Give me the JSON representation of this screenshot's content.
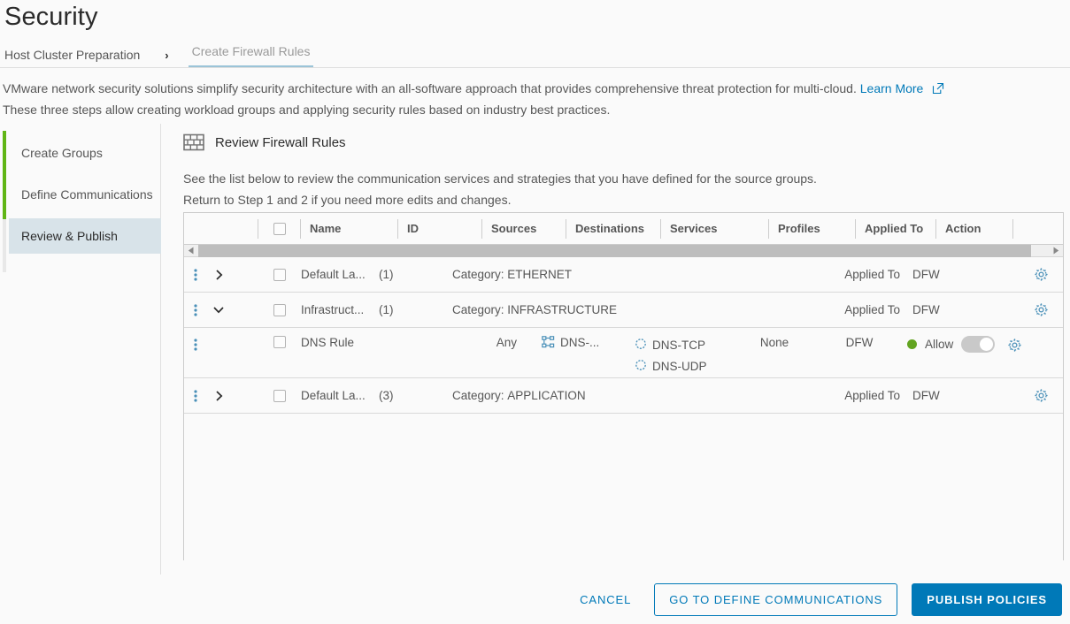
{
  "page": {
    "title": "Security"
  },
  "breadcrumb": {
    "root": "Host Cluster Preparation",
    "separator": "›",
    "current": "Create Firewall Rules"
  },
  "intro": {
    "line1_before_link": "VMware network security solutions simplify security architecture with an all-software approach that provides comprehensive threat protection for multi-cloud.",
    "link_label": "Learn More",
    "link_icon": "external-link-icon",
    "line2": "These three steps allow creating workload groups and applying security rules based on industry best practices."
  },
  "steps": {
    "items": [
      {
        "label": "Create Groups",
        "state": "complete"
      },
      {
        "label": "Define Communications",
        "state": "complete"
      },
      {
        "label": "Review & Publish",
        "state": "active"
      }
    ],
    "accent_color": "#60b515",
    "active_bg": "#d8e3e9"
  },
  "panel": {
    "icon": "firewall-brick-icon",
    "title": "Review Firewall Rules",
    "desc_line1": "See the list below to review the communication services and strategies that you have defined for the source groups.",
    "desc_line2": "Return to Step 1 and 2 if you need more edits and changes."
  },
  "table": {
    "columns": [
      "Name",
      "ID",
      "Sources",
      "Destinations",
      "Services",
      "Profiles",
      "Applied To",
      "Action"
    ],
    "select_all_checkbox": "unchecked",
    "scrollbar": {
      "left_arrow_icon": "triangle-left-icon",
      "right_arrow_icon": "triangle-right-icon",
      "thumb_position": "left"
    },
    "rows": [
      {
        "type": "group",
        "menu_icon": "kebab-menu-icon",
        "expand_icon": "chevron-right-icon",
        "expanded": false,
        "checkbox": "unchecked",
        "name": "Default La...",
        "id": "(1)",
        "category_label": "Category:",
        "category_value": "ETHERNET",
        "applied_to_label": "Applied To",
        "applied_to_value": "DFW",
        "gear_icon": "gear-icon"
      },
      {
        "type": "group",
        "menu_icon": "kebab-menu-icon",
        "expand_icon": "chevron-down-icon",
        "expanded": true,
        "checkbox": "unchecked",
        "name": "Infrastruct...",
        "id": "(1)",
        "category_label": "Category:",
        "category_value": "INFRASTRUCTURE",
        "applied_to_label": "Applied To",
        "applied_to_value": "DFW",
        "gear_icon": "gear-icon"
      },
      {
        "type": "rule",
        "menu_icon": "kebab-menu-icon",
        "checkbox": "unchecked",
        "name": "DNS Rule",
        "id": "",
        "sources": "Any",
        "destinations_icon": "group-network-icon",
        "destinations": "DNS-...",
        "services": [
          "DNS-TCP",
          "DNS-UDP"
        ],
        "services_icon": "service-cog-icon",
        "profiles": "None",
        "applied_to": "DFW",
        "action_status_color": "#62a420",
        "action": "Allow",
        "toggle_state": "on",
        "gear_icon": "gear-icon"
      },
      {
        "type": "group",
        "menu_icon": "kebab-menu-icon",
        "expand_icon": "chevron-right-icon",
        "expanded": false,
        "checkbox": "unchecked",
        "name": "Default La...",
        "id": "(3)",
        "category_label": "Category:",
        "category_value": "APPLICATION",
        "applied_to_label": "Applied To",
        "applied_to_value": "DFW",
        "gear_icon": "gear-icon"
      }
    ]
  },
  "footer": {
    "cancel": "CANCEL",
    "back": "GO TO DEFINE COMMUNICATIONS",
    "publish": "PUBLISH POLICIES",
    "accent_color": "#0079b8"
  }
}
